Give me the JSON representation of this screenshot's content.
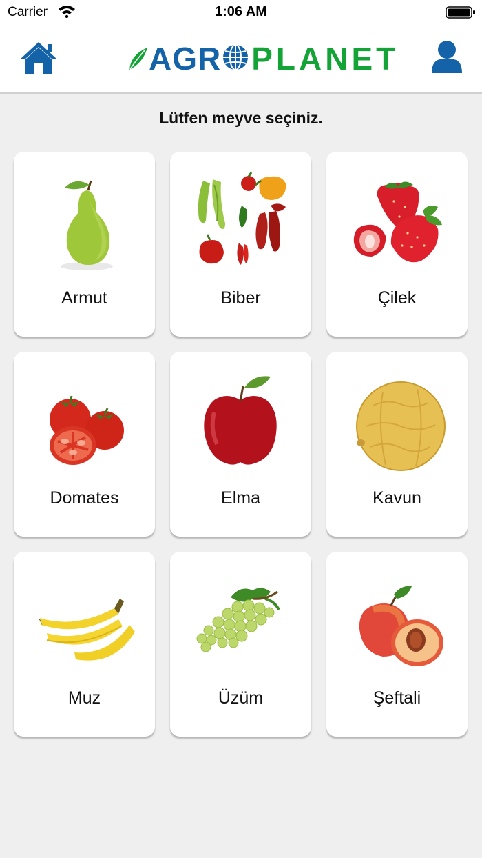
{
  "status": {
    "carrier": "Carrier",
    "time": "1:06 AM"
  },
  "header": {
    "logo_part1": "AGR",
    "logo_part2": "PLANET"
  },
  "prompt": "Lütfen meyve seçiniz.",
  "colors": {
    "brand_blue": "#1463a8",
    "brand_green": "#14a337",
    "background": "#efefef"
  },
  "fruits": [
    {
      "label": "Armut",
      "icon": "pear"
    },
    {
      "label": "Biber",
      "icon": "pepper"
    },
    {
      "label": "Çilek",
      "icon": "strawberry"
    },
    {
      "label": "Domates",
      "icon": "tomato"
    },
    {
      "label": "Elma",
      "icon": "apple"
    },
    {
      "label": "Kavun",
      "icon": "melon"
    },
    {
      "label": "Muz",
      "icon": "banana"
    },
    {
      "label": "Üzüm",
      "icon": "grapes"
    },
    {
      "label": "Şeftali",
      "icon": "peach"
    }
  ]
}
